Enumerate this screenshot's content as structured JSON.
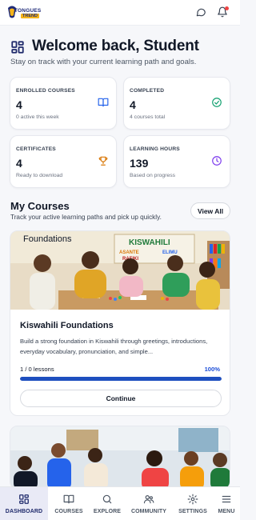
{
  "brand": {
    "line1": "TONGUES",
    "line2": "TREND",
    "accent": "#f5b41a",
    "primary": "#1e2a78"
  },
  "header": {
    "icons": [
      "chat-icon",
      "bell-icon"
    ]
  },
  "welcome": {
    "title": "Welcome back, Student",
    "subtitle": "Stay on track with your current learning path and goals."
  },
  "stats": [
    {
      "label": "ENROLLED COURSES",
      "value": "4",
      "note": "0 active this week",
      "icon": "book-open-icon"
    },
    {
      "label": "COMPLETED",
      "value": "4",
      "note": "4 courses total",
      "icon": "check-circle-icon"
    },
    {
      "label": "CERTIFICATES",
      "value": "4",
      "note": "Ready to download",
      "icon": "trophy-icon"
    },
    {
      "label": "LEARNING HOURS",
      "value": "139",
      "note": "Based on progress",
      "icon": "clock-icon"
    }
  ],
  "my_courses": {
    "title": "My Courses",
    "subtitle": "Track your active learning paths and pick up quickly.",
    "view_all": "View All"
  },
  "course": {
    "banner_label": "Foundations",
    "banner_board": "KISWAHILI",
    "board_words": [
      "ASANTE",
      "ELIMU",
      "RAFIKI"
    ],
    "name": "Kiswahili Foundations",
    "description": "Build a strong foundation in Kiswahili through greetings, introductions, everyday vocabulary, pronunciation, and simple...",
    "lessons": "1 / 0 lessons",
    "progress_label": "100%",
    "progress": 1.0,
    "continue": "Continue"
  },
  "nav": [
    {
      "label": "DASHBOARD",
      "icon": "dashboard-icon",
      "active": true
    },
    {
      "label": "COURSES",
      "icon": "book-icon",
      "active": false
    },
    {
      "label": "EXPLORE",
      "icon": "search-icon",
      "active": false
    },
    {
      "label": "COMMUNITY",
      "icon": "users-icon",
      "active": false
    },
    {
      "label": "SETTINGS",
      "icon": "gear-icon",
      "active": false
    },
    {
      "label": "MENU",
      "icon": "menu-icon",
      "active": false
    }
  ]
}
